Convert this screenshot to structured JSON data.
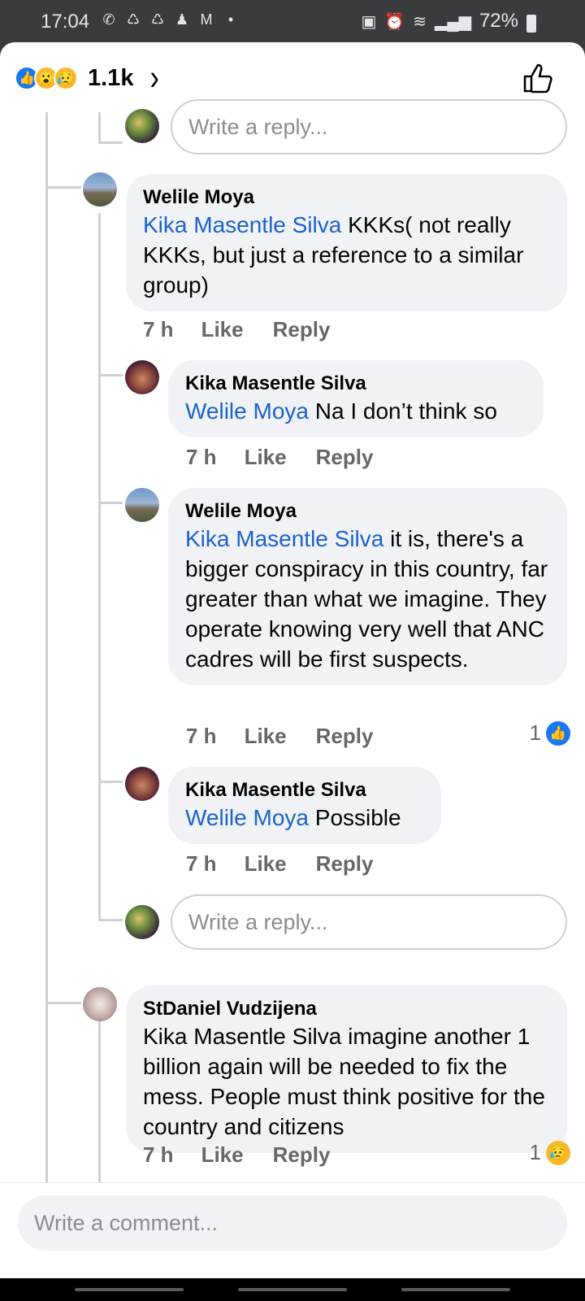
{
  "status_bar": {
    "time": "17:04",
    "battery": "72%",
    "notification_icons": [
      "whatsapp-icon",
      "recycle-icon",
      "recycle-icon",
      "person-icon",
      "gmail-icon",
      "dot-icon"
    ],
    "system_icons": [
      "lock-icon",
      "alarm-icon",
      "wifi-icon",
      "signal-icon",
      "battery-icon"
    ]
  },
  "header": {
    "reaction_icons": [
      "like",
      "wow",
      "sad"
    ],
    "reaction_count": "1.1k",
    "chevron": "›"
  },
  "reply_placeholder": "Write a reply...",
  "comments": [
    {
      "author": "Welile Moya",
      "mention": "Kika Masentle Silva",
      "text": " KKKs( not really KKKs, but just a reference to a similar group)",
      "time": "7 h",
      "like": "Like",
      "reply": "Reply"
    },
    {
      "author": "Kika Masentle Silva",
      "mention": "Welile Moya",
      "text": " Na I don’t think so",
      "time": "7 h",
      "like": "Like",
      "reply": "Reply"
    },
    {
      "author": "Welile Moya",
      "mention": "Kika Masentle Silva",
      "text": " it is, there's a bigger conspiracy in this country, far greater than what we imagine. They operate knowing very well that ANC cadres will be first suspects.",
      "time": "7 h",
      "like": "Like",
      "reply": "Reply",
      "reaction_count": "1",
      "reaction_type": "like"
    },
    {
      "author": "Kika Masentle Silva",
      "mention": "Welile Moya",
      "text": " Possible",
      "time": "7 h",
      "like": "Like",
      "reply": "Reply"
    },
    {
      "author": "StDaniel Vudzijena",
      "text": "Kika Masentle Silva imagine another 1 billion again will be needed  to fix the mess. People must think positive for the country and citizens",
      "time": "7 h",
      "like": "Like",
      "reply": "Reply",
      "reaction_count": "1",
      "reaction_type": "sad"
    }
  ],
  "comment_placeholder": "Write a comment...",
  "colors": {
    "mention": "#1b63c9",
    "bubble": "#f0f2f5",
    "like_blue": "#1877f2",
    "meta_gray": "#65676b"
  }
}
